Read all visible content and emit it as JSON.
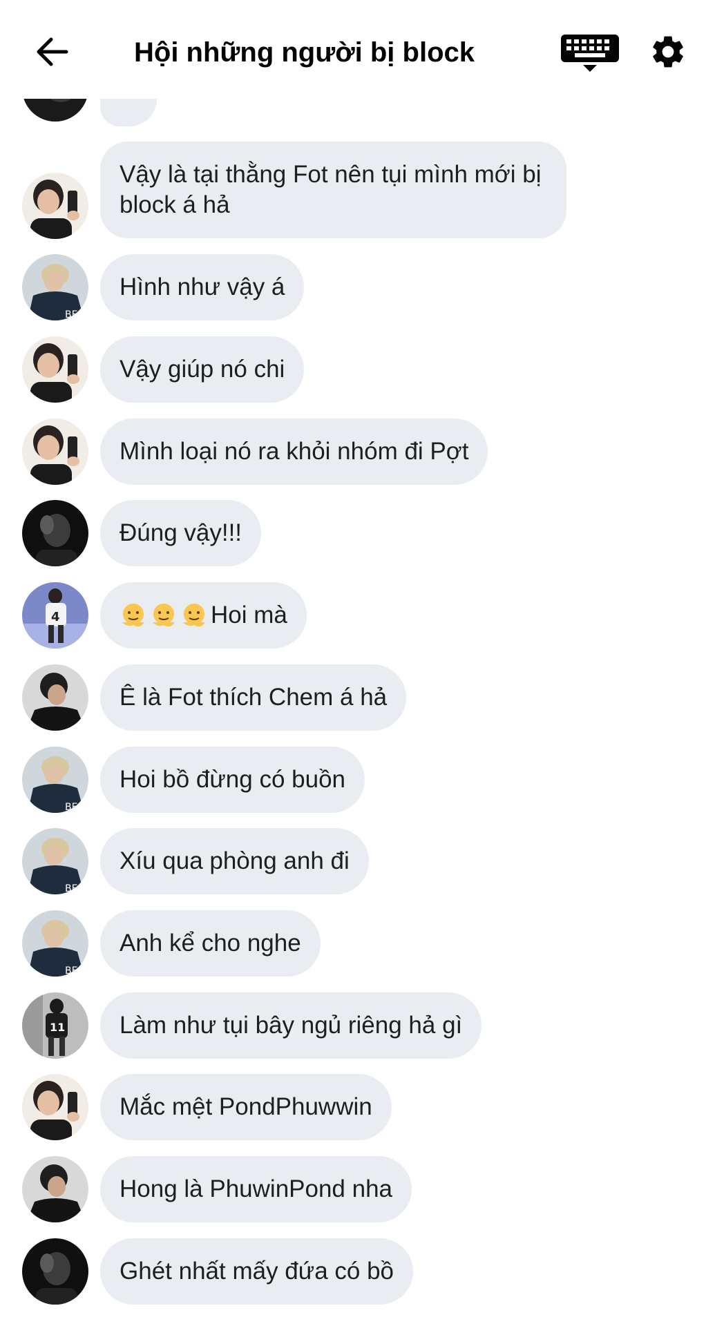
{
  "header": {
    "title": "Hội những người bị block",
    "icons": {
      "back": "arrow-left-icon",
      "keyboard": "keyboard-icon",
      "settings": "gear-icon"
    }
  },
  "colors": {
    "bubble": "#e9edf1",
    "text": "#050505"
  },
  "messages": [
    {
      "avatar": "avatar-boy-mirror",
      "text": "Vậy là tại thằng Fot nên tụi mình mới bị block á hả"
    },
    {
      "avatar": "avatar-blond-jacket",
      "text": "Hình như vậy á"
    },
    {
      "avatar": "avatar-boy-mirror",
      "text": "Vậy giúp nó chi"
    },
    {
      "avatar": "avatar-boy-mirror",
      "text": "Mình loại nó ra khỏi nhóm đi Pợt"
    },
    {
      "avatar": "avatar-dark-hand",
      "text": "Đúng vậy!!!"
    },
    {
      "avatar": "avatar-jersey-4",
      "text": "Hoi mà",
      "emoji": "melting-face-icon"
    },
    {
      "avatar": "avatar-boy-side",
      "text": "Ê là Fot thích Chem á hả"
    },
    {
      "avatar": "avatar-blond-jacket",
      "text": "Hoi bồ đừng có buồn"
    },
    {
      "avatar": "avatar-blond-jacket",
      "text": "Xíu qua phòng anh đi"
    },
    {
      "avatar": "avatar-blond-jacket",
      "text": "Anh kể cho nghe"
    },
    {
      "avatar": "avatar-jersey-11",
      "text": "Làm như tụi bây ngủ riêng hả gì"
    },
    {
      "avatar": "avatar-boy-mirror",
      "text": "Mắc mệt PondPhuwwin"
    },
    {
      "avatar": "avatar-boy-side",
      "text": "Hong là PhuwinPond nha"
    },
    {
      "avatar": "avatar-dark-hand",
      "text": "Ghét nhất mấy đứa có bồ"
    }
  ]
}
